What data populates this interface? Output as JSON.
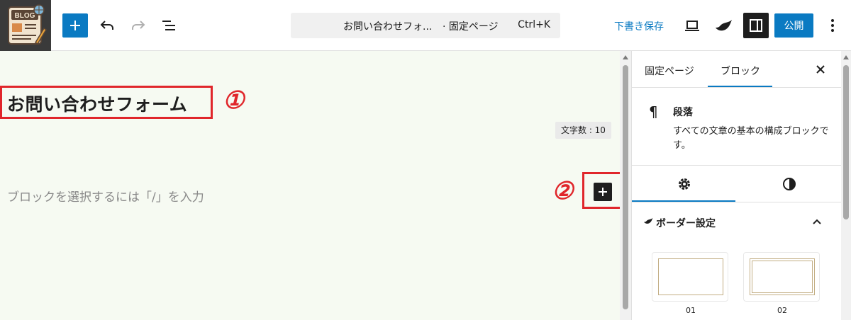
{
  "header": {
    "logo_text": "BLOG",
    "document_title": "お問い合わせフォ...",
    "document_type": "· 固定ページ",
    "shortcut": "Ctrl+K",
    "save_draft_label": "下書き保存",
    "publish_label": "公開"
  },
  "editor": {
    "page_title": "お問い合わせフォーム",
    "annotation_1": "①",
    "annotation_2": "②",
    "char_count": "文字数 : 10",
    "paragraph_placeholder": "ブロックを選択するには「/」を入力"
  },
  "sidebar": {
    "tabs": [
      {
        "label": "固定ページ",
        "active": false
      },
      {
        "label": "ブロック",
        "active": true
      }
    ],
    "block": {
      "name": "段落",
      "description": "すべての文章の基本の構成ブロックです。"
    },
    "border_panel": {
      "title": "ボーダー設定",
      "options": [
        {
          "label": "01"
        },
        {
          "label": "02"
        }
      ]
    }
  },
  "colors": {
    "accent": "#0a7ac2",
    "annotation": "#e0262b",
    "canvas_bg": "#f6faf2",
    "border_style_gold": "#c2ad82"
  }
}
